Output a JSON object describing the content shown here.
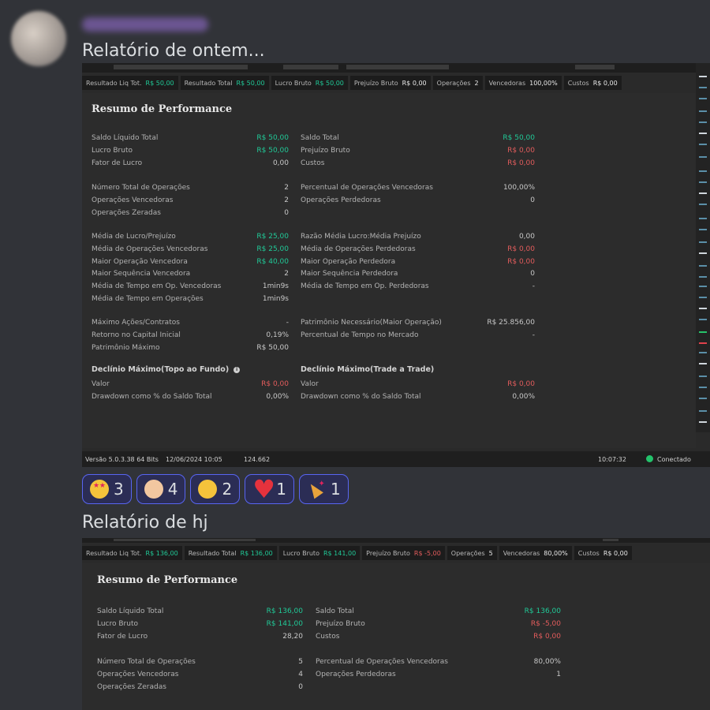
{
  "messages": [
    {
      "text": "Relatório de ontem..."
    },
    {
      "text": "Relatório de hj"
    }
  ],
  "reactions": [
    {
      "emoji": "star-struck",
      "count": "3"
    },
    {
      "emoji": "clapping-hands",
      "count": "4"
    },
    {
      "emoji": "thumbs-up",
      "count": "2"
    },
    {
      "emoji": "red-heart",
      "count": "1"
    },
    {
      "emoji": "party-popper",
      "count": "1"
    }
  ],
  "report1": {
    "metrics": [
      {
        "label": "Resultado Liq Tot.",
        "value": "R$ 50,00",
        "color": "green"
      },
      {
        "label": "Resultado Total",
        "value": "R$ 50,00",
        "color": "green"
      },
      {
        "label": "Lucro Bruto",
        "value": "R$ 50,00",
        "color": "green"
      },
      {
        "label": "Prejuízo Bruto",
        "value": "R$ 0,00",
        "color": ""
      },
      {
        "label": "Operações",
        "value": "2",
        "color": ""
      },
      {
        "label": "Vencedoras",
        "value": "100,00%",
        "color": ""
      },
      {
        "label": "Custos",
        "value": "R$ 0,00",
        "color": ""
      }
    ],
    "title": "Resumo de Performance",
    "left": [
      {
        "label": "Saldo Líquido Total",
        "value": "R$ 50,00",
        "color": "green"
      },
      {
        "label": "Lucro Bruto",
        "value": "R$ 50,00",
        "color": "green"
      },
      {
        "label": "Fator de Lucro",
        "value": "0,00",
        "color": ""
      },
      {
        "label": "Número Total de Operações",
        "value": "2",
        "color": ""
      },
      {
        "label": "Operações Vencedoras",
        "value": "2",
        "color": ""
      },
      {
        "label": "Operações Zeradas",
        "value": "0",
        "color": ""
      },
      {
        "label": "Média de Lucro/Prejuízo",
        "value": "R$ 25,00",
        "color": "green"
      },
      {
        "label": "Média de Operações Vencedoras",
        "value": "R$ 25,00",
        "color": "green"
      },
      {
        "label": "Maior Operação Vencedora",
        "value": "R$ 40,00",
        "color": "green"
      },
      {
        "label": "Maior Sequência Vencedora",
        "value": "2",
        "color": ""
      },
      {
        "label": "Média de Tempo em Op. Vencedoras",
        "value": "1min9s",
        "color": ""
      },
      {
        "label": "Média de Tempo em Operações",
        "value": "1min9s",
        "color": ""
      },
      {
        "label": "Máximo Ações/Contratos",
        "value": "-",
        "color": ""
      },
      {
        "label": "Retorno no Capital Inicial",
        "value": "0,19%",
        "color": ""
      },
      {
        "label": "Patrimônio Máximo",
        "value": "R$ 50,00",
        "color": ""
      }
    ],
    "right": [
      {
        "label": "Saldo Total",
        "value": "R$ 50,00",
        "color": "green"
      },
      {
        "label": "Prejuízo Bruto",
        "value": "R$ 0,00",
        "color": "red"
      },
      {
        "label": "Custos",
        "value": "R$ 0,00",
        "color": "red"
      },
      {
        "label": "Percentual de Operações Vencedoras",
        "value": "100,00%",
        "color": ""
      },
      {
        "label": "Operações Perdedoras",
        "value": "0",
        "color": ""
      },
      {
        "label": "Razão Média Lucro:Média Prejuízo",
        "value": "0,00",
        "color": ""
      },
      {
        "label": "Média de Operações Perdedoras",
        "value": "R$ 0,00",
        "color": "red"
      },
      {
        "label": "Maior Operação Perdedora",
        "value": "R$ 0,00",
        "color": "red"
      },
      {
        "label": "Maior Sequência Perdedora",
        "value": "0",
        "color": ""
      },
      {
        "label": "Média de Tempo em Op. Perdedoras",
        "value": "-",
        "color": ""
      },
      {
        "label": "Patrimônio Necessário(Maior Operação)",
        "value": "R$ 25.856,00",
        "color": ""
      },
      {
        "label": "Percentual de Tempo no Mercado",
        "value": "-",
        "color": ""
      }
    ],
    "drawdown_left": {
      "title": "Declínio Máximo(Topo ao Fundo)",
      "rows": [
        {
          "label": "Valor",
          "value": "R$ 0,00",
          "color": "red"
        },
        {
          "label": "Drawdown como % do Saldo Total",
          "value": "0,00%",
          "color": ""
        }
      ]
    },
    "drawdown_right": {
      "title": "Declínio Máximo(Trade a Trade)",
      "rows": [
        {
          "label": "Valor",
          "value": "R$ 0,00",
          "color": "red"
        },
        {
          "label": "Drawdown como % do Saldo Total",
          "value": "0,00%",
          "color": ""
        }
      ]
    },
    "status": {
      "version": "Versão 5.0.3.38 64 Bits",
      "datetime": "12/06/2024 10:05",
      "value": "124.662",
      "time": "10:07:32",
      "connection": "Conectado"
    }
  },
  "report2": {
    "metrics": [
      {
        "label": "Resultado Liq Tot.",
        "value": "R$ 136,00",
        "color": "green"
      },
      {
        "label": "Resultado Total",
        "value": "R$ 136,00",
        "color": "green"
      },
      {
        "label": "Lucro Bruto",
        "value": "R$ 141,00",
        "color": "green"
      },
      {
        "label": "Prejuízo Bruto",
        "value": "R$ -5,00",
        "color": "red"
      },
      {
        "label": "Operações",
        "value": "5",
        "color": ""
      },
      {
        "label": "Vencedoras",
        "value": "80,00%",
        "color": ""
      },
      {
        "label": "Custos",
        "value": "R$ 0,00",
        "color": ""
      }
    ],
    "title": "Resumo de Performance",
    "left": [
      {
        "label": "Saldo Líquido Total",
        "value": "R$ 136,00",
        "color": "green"
      },
      {
        "label": "Lucro Bruto",
        "value": "R$ 141,00",
        "color": "green"
      },
      {
        "label": "Fator de Lucro",
        "value": "28,20",
        "color": ""
      },
      {
        "label": "Número Total de Operações",
        "value": "5",
        "color": ""
      },
      {
        "label": "Operações Vencedoras",
        "value": "4",
        "color": ""
      },
      {
        "label": "Operações Zeradas",
        "value": "0",
        "color": ""
      }
    ],
    "right": [
      {
        "label": "Saldo Total",
        "value": "R$ 136,00",
        "color": "green"
      },
      {
        "label": "Prejuízo Bruto",
        "value": "R$ -5,00",
        "color": "red"
      },
      {
        "label": "Custos",
        "value": "R$ 0,00",
        "color": "red"
      },
      {
        "label": "Percentual de Operações Vencedoras",
        "value": "80,00%",
        "color": ""
      },
      {
        "label": "Operações Perdedoras",
        "value": "1",
        "color": ""
      }
    ]
  }
}
